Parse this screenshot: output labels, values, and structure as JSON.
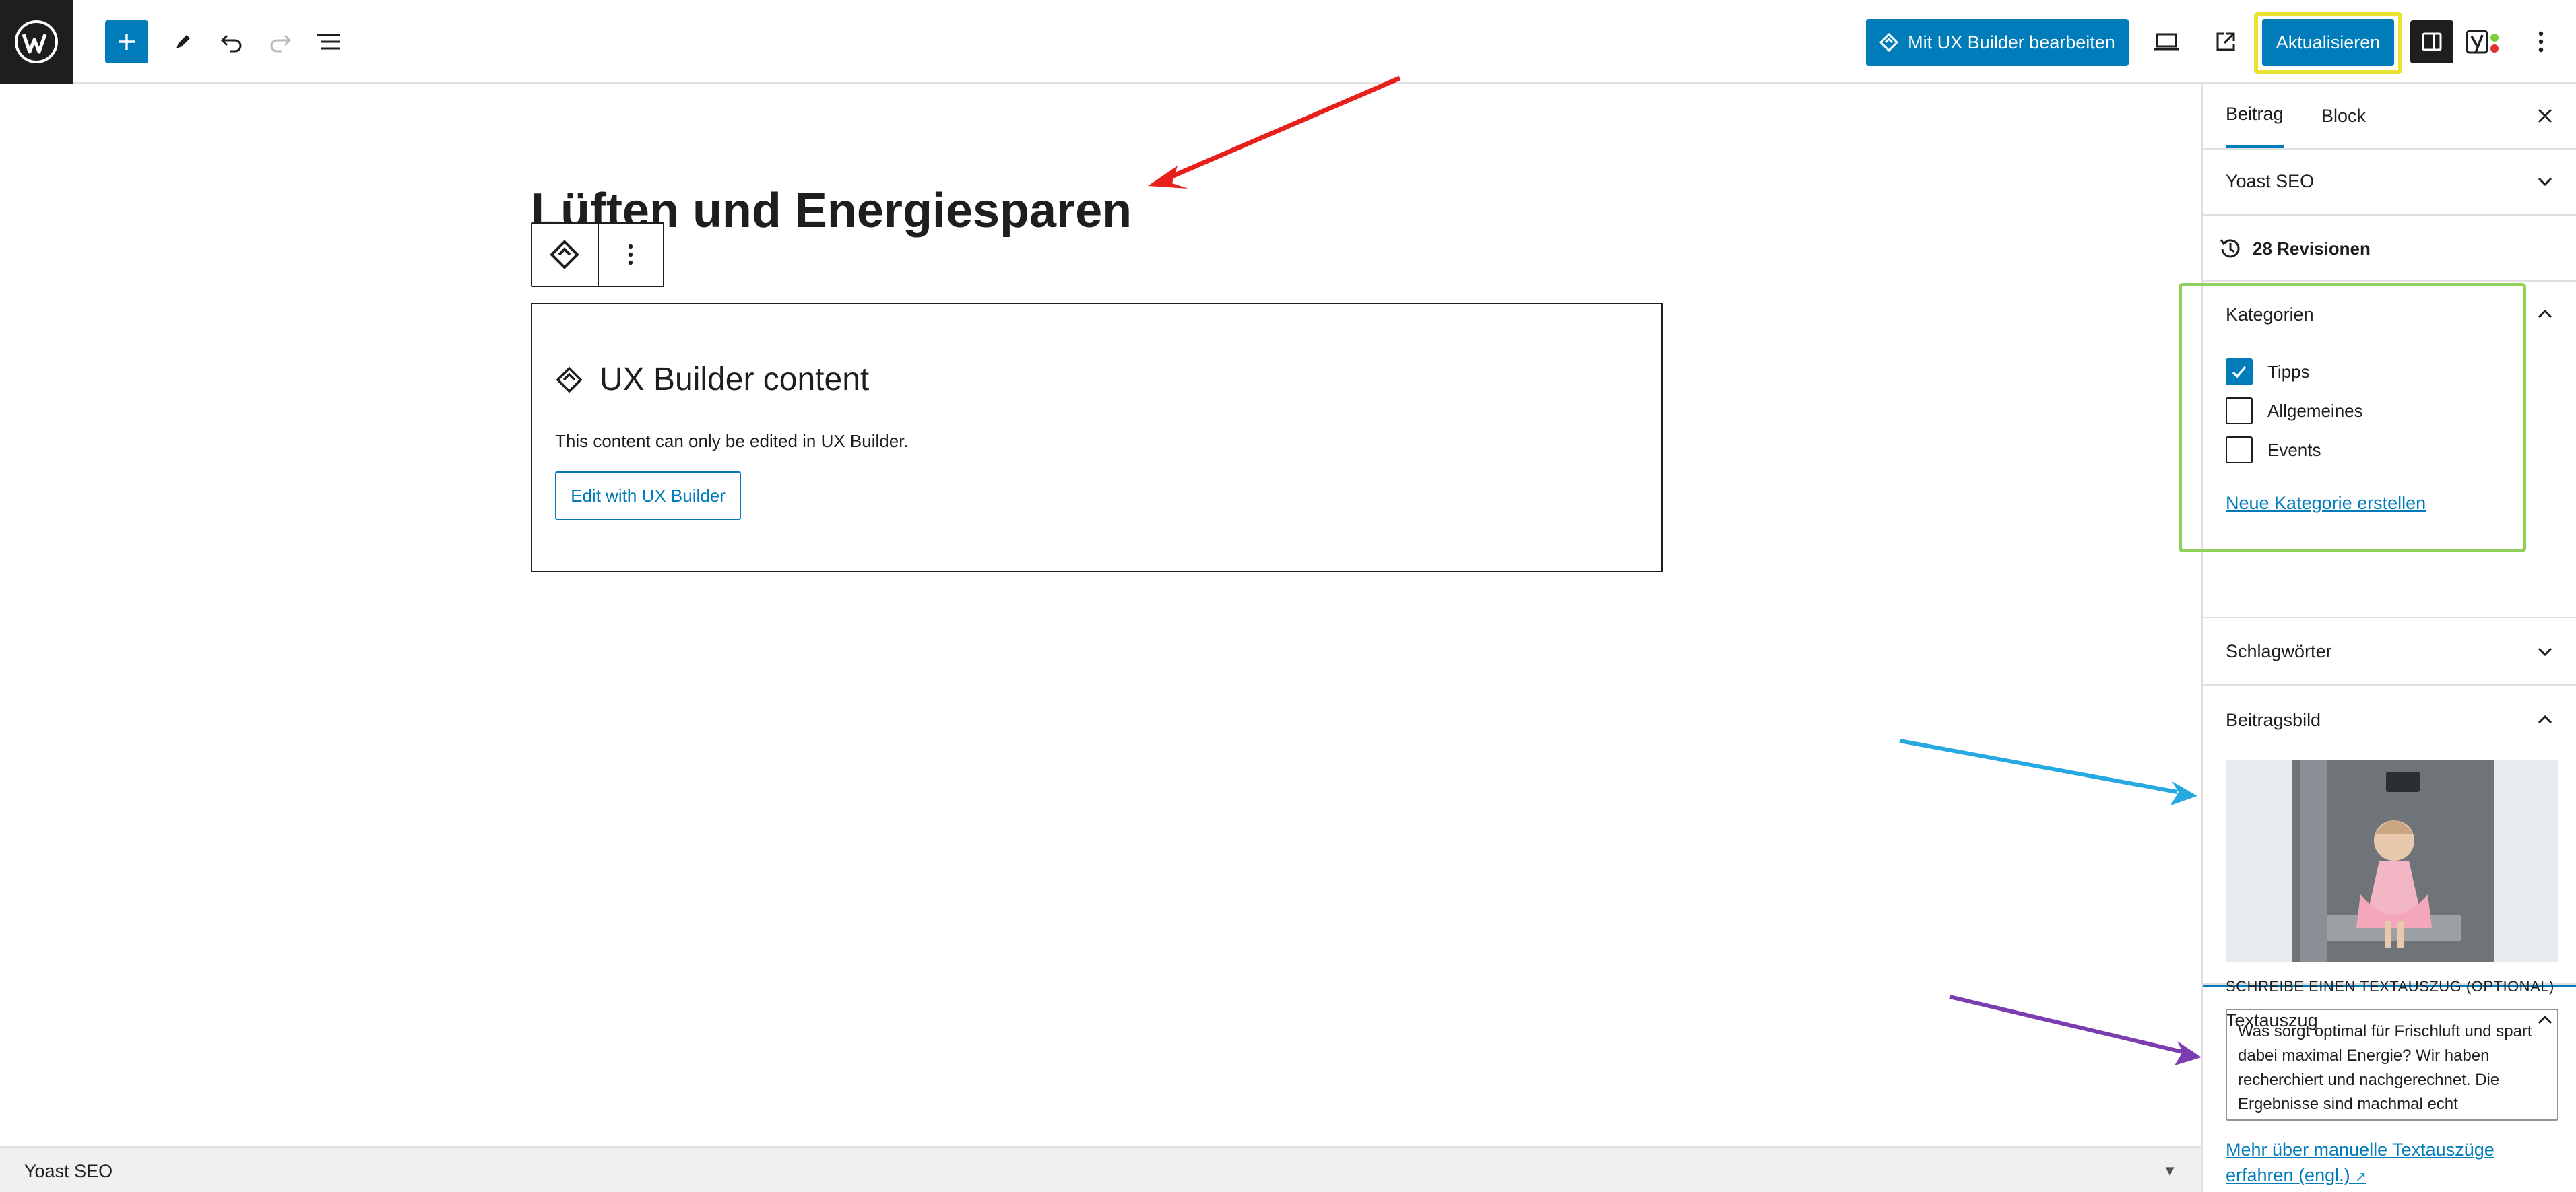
{
  "header": {
    "ux_builder_button": "Mit UX Builder bearbeiten",
    "update_button": "Aktualisieren"
  },
  "editor": {
    "post_title": "Lüften und Energiesparen",
    "ux_block": {
      "heading": "UX Builder content",
      "description": "This content can only be edited in UX Builder.",
      "button": "Edit with UX Builder"
    }
  },
  "bottom_bar": {
    "label": "Yoast SEO"
  },
  "sidebar": {
    "tabs": [
      "Beitrag",
      "Block"
    ],
    "panels": {
      "yoast": "Yoast SEO",
      "revisions": "28 Revisionen",
      "categories": {
        "title": "Kategorien",
        "items": [
          {
            "label": "Tipps",
            "checked": true
          },
          {
            "label": "Allgemeines",
            "checked": false
          },
          {
            "label": "Events",
            "checked": false
          }
        ],
        "new_link": "Neue Kategorie erstellen"
      },
      "tags": "Schlagwörter",
      "featured_image": "Beitragsbild",
      "excerpt": {
        "title": "Textauszug",
        "label": "Schreibe einen Textauszug (optional)",
        "value": "Was sorgt optimal für Frischluft und spart dabei maximal Energie? Wir haben recherchiert und nachgerechnet. Die Ergebnisse sind machmal echt überraschend.",
        "learn_more": "Mehr über manuelle Textauszüge erfahren (engl.)"
      }
    }
  },
  "colors": {
    "accent": "#007cba",
    "dark": "#1e1e1e",
    "highlight_yellow": "#e8e12e",
    "highlight_green": "#8fd05a",
    "arrow_red": "#e8201c",
    "arrow_blue": "#25a9e0",
    "arrow_purple": "#7b3db0"
  },
  "icons": [
    "wordpress-logo-icon",
    "plus-icon",
    "pen-icon",
    "undo-icon",
    "redo-icon",
    "list-view-icon",
    "ux-builder-icon",
    "laptop-preview-icon",
    "external-link-icon",
    "sidebar-toggle-icon",
    "yoast-icon",
    "more-vertical-icon",
    "close-icon",
    "chevron-down-icon",
    "chevron-up-icon",
    "history-icon",
    "check-icon"
  ]
}
